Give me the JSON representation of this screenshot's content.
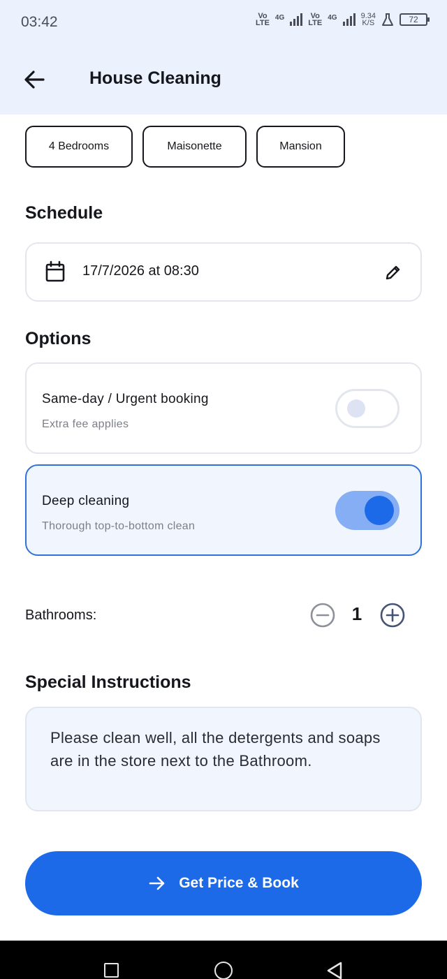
{
  "status_bar": {
    "time": "03:42",
    "sim1_label_top": "Vo",
    "sim1_label_bottom": "LTE",
    "sim1_network": "4G",
    "sim2_label_top": "Vo",
    "sim2_label_bottom": "LTE",
    "sim2_network": "4G",
    "speed_value": "9.34",
    "speed_unit": "K/S",
    "battery": "72"
  },
  "app_bar": {
    "title": "House Cleaning",
    "back_icon": "arrow-left-icon"
  },
  "property_types": [
    "4 Bedrooms",
    "Maisonette",
    "Mansion"
  ],
  "schedule": {
    "heading": "Schedule",
    "value": "17/7/2026 at 08:30",
    "icon": "calendar-icon",
    "edit_icon": "pencil-icon"
  },
  "options": {
    "heading": "Options",
    "items": [
      {
        "title": "Same-day / Urgent booking",
        "subtitle": "Extra fee applies",
        "enabled": false
      },
      {
        "title": "Deep cleaning",
        "subtitle": "Thorough top-to-bottom clean",
        "enabled": true
      }
    ]
  },
  "bathrooms": {
    "label": "Bathrooms:",
    "count": "1"
  },
  "special_instructions": {
    "heading": "Special Instructions",
    "value": "Please clean well, all the detergents and soaps are in the store next to the Bathroom."
  },
  "cta": {
    "label": "Get Price & Book",
    "icon": "arrow-right-icon"
  },
  "colors": {
    "primary": "#1c6ae8",
    "app_bar_bg": "#ebf1fd",
    "card_active_border": "#2f73d8"
  }
}
